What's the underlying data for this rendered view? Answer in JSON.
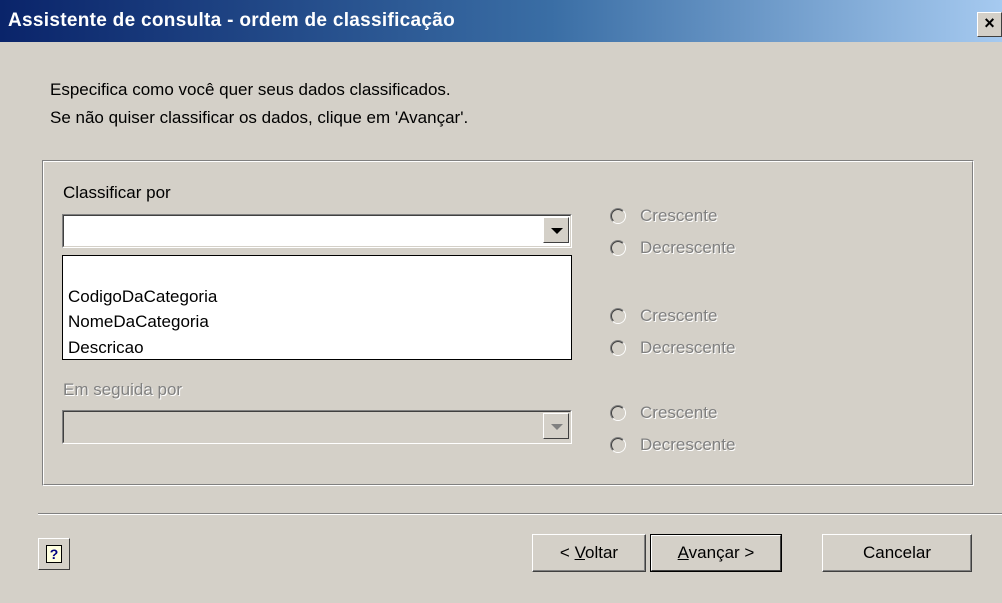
{
  "window": {
    "title": "Assistente de consulta - ordem de classificação",
    "close_label": "×"
  },
  "instructions": [
    "Especifica como você quer seus dados classificados.",
    "Se não quiser classificar os dados, clique em 'Avançar'."
  ],
  "sort": {
    "primary_label": "Classificar por",
    "primary_value": "",
    "dropdown_options": [
      "",
      "CodigoDaCategoria",
      "NomeDaCategoria",
      "Descricao"
    ],
    "secondary_label": "Em seguida por",
    "secondary_value": ""
  },
  "radios": {
    "asc": "Crescente",
    "desc": "Decrescente"
  },
  "buttons": {
    "help": "?",
    "back_prefix": "< ",
    "back_key": "V",
    "back_rest": "oltar",
    "next_key": "A",
    "next_rest": "vançar >",
    "cancel": "Cancelar"
  },
  "colors": {
    "titlebar_start": "#0a246a",
    "titlebar_end": "#a6caf0",
    "dialog_bg": "#d4d0c8",
    "disabled_text": "#808080"
  }
}
